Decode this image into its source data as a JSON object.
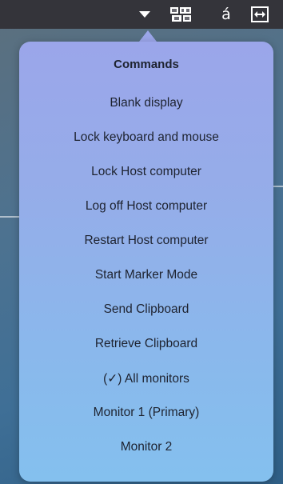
{
  "topbar": {
    "icons": [
      "triangle-down-icon",
      "keyboard-icon",
      "accent-character-icon",
      "fit-to-window-icon"
    ],
    "accent_glyph": "á"
  },
  "menu": {
    "header": "Commands",
    "items": [
      {
        "label": "Blank display"
      },
      {
        "label": "Lock keyboard and mouse"
      },
      {
        "label": "Lock Host computer"
      },
      {
        "label": "Log off Host computer"
      },
      {
        "label": "Restart Host computer"
      },
      {
        "label": "Start Marker Mode"
      },
      {
        "label": "Send Clipboard"
      },
      {
        "label": "Retrieve Clipboard"
      },
      {
        "label": "All monitors",
        "prefix_open": "(",
        "check_glyph": "✓",
        "prefix_close": ") ",
        "checked": true
      },
      {
        "label": "Monitor 1 (Primary)"
      },
      {
        "label": "Monitor 2"
      }
    ]
  },
  "colors": {
    "topbar": "#34343a",
    "menu_top": "#9ba6ea",
    "menu_bottom": "#84c0ee",
    "text": "#1e2330"
  }
}
